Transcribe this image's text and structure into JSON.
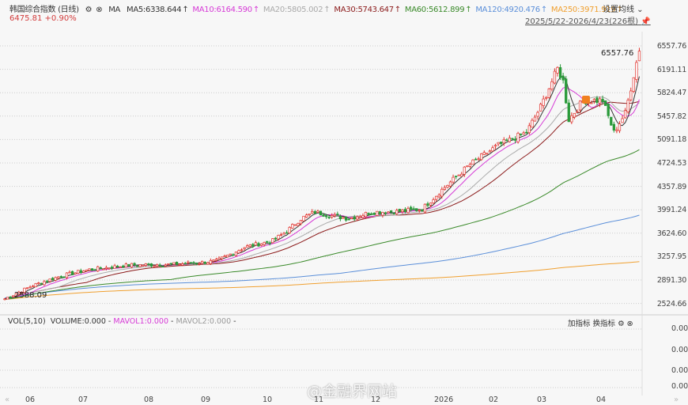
{
  "header": {
    "title": "韩国综合指数 (日线)",
    "ma_label": "MA",
    "ma": [
      {
        "label": "MA5:6338.644",
        "color": "#333333"
      },
      {
        "label": "MA10:6164.590",
        "color": "#d63ad6"
      },
      {
        "label": "MA20:5805.002",
        "color": "#aaaaaa"
      },
      {
        "label": "MA30:5743.647",
        "color": "#8b1a1a"
      },
      {
        "label": "MA60:5612.899",
        "color": "#3a8a2a"
      },
      {
        "label": "MA120:4920.476",
        "color": "#5b8fd9"
      },
      {
        "label": "MA250:3971.919",
        "color": "#f0a030"
      }
    ],
    "price": "6475.81",
    "change": "+0.90%",
    "settings": "设置均线",
    "range": "2025/5/22-2026/4/23(226根)"
  },
  "vol": {
    "label": "VOL(5,10)",
    "volume": "VOLUME:0.000",
    "mavol1": "MAVOL1:0.000",
    "mavol2": "MAVOL2:0.000",
    "add": "加指标",
    "switch": "换指标",
    "axis": [
      "0.00",
      "0.00",
      "0.00",
      "0.00"
    ]
  },
  "watermark": "@金融界网站",
  "chart_data": {
    "type": "candlestick",
    "bars": 226,
    "ylim": [
      2524.66,
      6557.76
    ],
    "yticks": [
      "6557.76",
      "6191.11",
      "5824.47",
      "5457.82",
      "5091.18",
      "4724.53",
      "4357.89",
      "3991.24",
      "3624.60",
      "3257.95",
      "2891.30",
      "2524.66"
    ],
    "xticks": [
      "06",
      "07",
      "08",
      "09",
      "10",
      "11",
      "12",
      "2026",
      "02",
      "03",
      "04"
    ],
    "high_label": "6557.76",
    "low_label": "2588.09",
    "close_path": [
      [
        0,
        2590
      ],
      [
        10,
        2800
      ],
      [
        20,
        2950
      ],
      [
        30,
        3050
      ],
      [
        45,
        3120
      ],
      [
        60,
        3130
      ],
      [
        75,
        3180
      ],
      [
        85,
        3400
      ],
      [
        95,
        3500
      ],
      [
        100,
        3650
      ],
      [
        105,
        3850
      ],
      [
        110,
        3950
      ],
      [
        115,
        3900
      ],
      [
        122,
        3850
      ],
      [
        130,
        3950
      ],
      [
        140,
        3960
      ],
      [
        148,
        4000
      ],
      [
        155,
        4300
      ],
      [
        165,
        4700
      ],
      [
        175,
        5000
      ],
      [
        185,
        5200
      ],
      [
        190,
        5600
      ],
      [
        196,
        6200
      ],
      [
        198,
        6000
      ],
      [
        200,
        5400
      ],
      [
        205,
        5700
      ],
      [
        212,
        5700
      ],
      [
        216,
        5200
      ],
      [
        220,
        5500
      ],
      [
        224,
        6300
      ],
      [
        225,
        6475
      ]
    ]
  }
}
